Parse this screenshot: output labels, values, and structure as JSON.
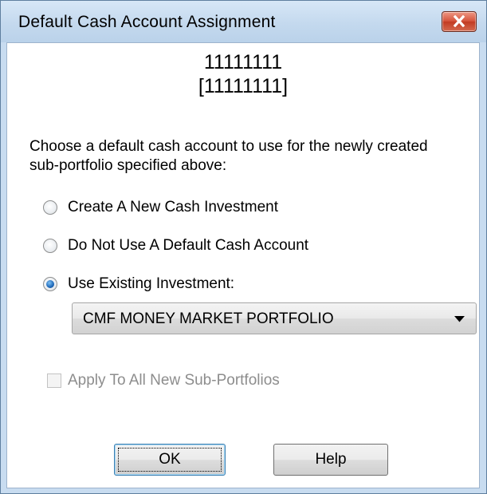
{
  "window": {
    "title": "Default Cash Account Assignment"
  },
  "portfolio": {
    "name": "11111111",
    "code": "[11111111]"
  },
  "prompt": "Choose a default cash account to use for the newly created sub-portfolio specified above:",
  "options": [
    {
      "label": "Create A New Cash Investment",
      "checked": false
    },
    {
      "label": "Do Not Use A Default Cash Account",
      "checked": false
    },
    {
      "label": "Use Existing Investment:",
      "checked": true
    }
  ],
  "investment_select": {
    "value": "CMF MONEY MARKET PORTFOLIO"
  },
  "apply_all": {
    "label": "Apply To All New Sub-Portfolios",
    "checked": false,
    "enabled": false
  },
  "buttons": {
    "ok": "OK",
    "help": "Help"
  },
  "icons": {
    "close": "close-icon",
    "dropdown": "chevron-down-icon"
  },
  "colors": {
    "titlebar": "#c8dcf0",
    "close_button": "#c94a30",
    "radio_selected": "#1d67b8",
    "disabled_text": "#8d8d8d"
  }
}
